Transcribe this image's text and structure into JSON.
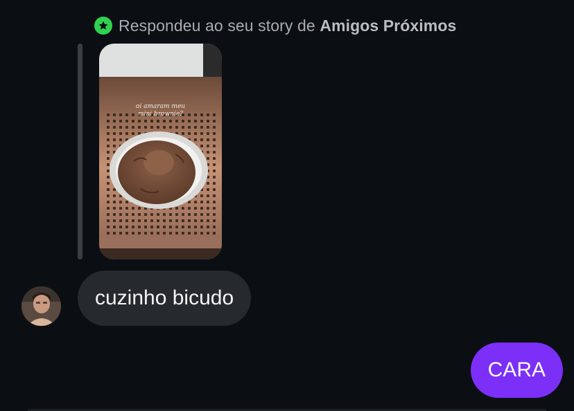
{
  "reply_header": {
    "prefix": "Respondeu ao seu story de",
    "list_name": "Amigos Próximos",
    "badge_icon": "star-icon",
    "badge_color": "#2fd24f"
  },
  "story": {
    "caption_line1": "oi amaram meu",
    "caption_line2": "mini brownie?"
  },
  "messages": [
    {
      "direction": "incoming",
      "text": "cuzinho bicudo",
      "bubble_color": "#262a2f"
    },
    {
      "direction": "outgoing",
      "text": "CARA",
      "bubble_color": "#7b2ff7"
    }
  ],
  "colors": {
    "background": "#0b0f13",
    "accent": "#7b2ff7"
  }
}
